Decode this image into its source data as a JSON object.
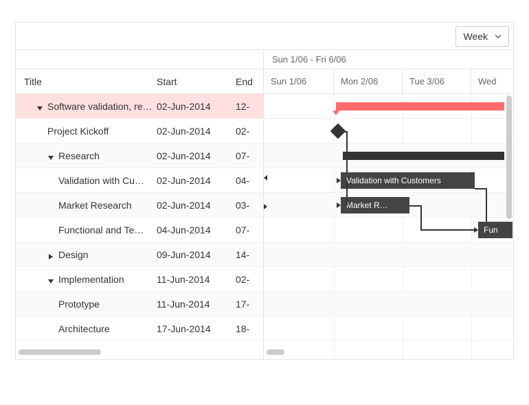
{
  "toolbar": {
    "view_select_value": "Week"
  },
  "grid": {
    "headers": {
      "title": "Title",
      "start": "Start",
      "end": "End"
    },
    "rows": [
      {
        "title": "Software validation, res…",
        "start": "02-Jun-2014",
        "end": "12-"
      },
      {
        "title": "Project Kickoff",
        "start": "02-Jun-2014",
        "end": "02-"
      },
      {
        "title": "Research",
        "start": "02-Jun-2014",
        "end": "07-"
      },
      {
        "title": "Validation with Cu…",
        "start": "02-Jun-2014",
        "end": "04-"
      },
      {
        "title": "Market Research",
        "start": "02-Jun-2014",
        "end": "03-"
      },
      {
        "title": "Functional and Te…",
        "start": "04-Jun-2014",
        "end": "07-"
      },
      {
        "title": "Design",
        "start": "09-Jun-2014",
        "end": "14-"
      },
      {
        "title": "Implementation",
        "start": "11-Jun-2014",
        "end": "02-"
      },
      {
        "title": "Prototype",
        "start": "11-Jun-2014",
        "end": "17-"
      },
      {
        "title": "Architecture",
        "start": "17-Jun-2014",
        "end": "18-"
      }
    ]
  },
  "timeline": {
    "range_label": "Sun 1/06 - Fri 6/06",
    "days": [
      "Sun 1/06",
      "Mon 2/06",
      "Tue 3/06",
      "Wed"
    ],
    "bar_labels": {
      "validation": "Validation with Customers",
      "market": "Market R…",
      "functional": "Fun"
    }
  }
}
